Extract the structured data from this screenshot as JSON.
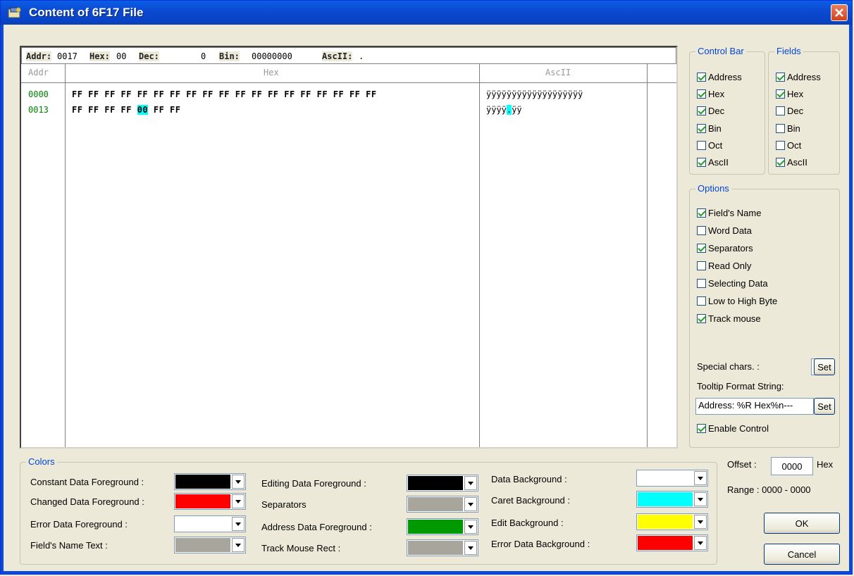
{
  "window": {
    "title": "Content of 6F17 File"
  },
  "control_bar": {
    "addr_label": "Addr:",
    "addr_value": "0017",
    "hex_label": "Hex:",
    "hex_value": "00",
    "dec_label": "Dec:",
    "dec_value": "0",
    "bin_label": "Bin:",
    "bin_value": "00000000",
    "ascii_label": "AscII:",
    "ascii_value": "."
  },
  "grid": {
    "headers": {
      "addr": "Addr",
      "hex": "Hex",
      "ascii": "AscII"
    },
    "rows": [
      {
        "addr": "0000",
        "hex_before": "FF FF FF FF FF FF FF FF FF FF FF FF FF FF FF FF FF FF FF",
        "hex_sel": "",
        "hex_after": "",
        "ascii_before": "ÿÿÿÿÿÿÿÿÿÿÿÿÿÿÿÿÿÿÿ",
        "ascii_sel": "",
        "ascii_after": ""
      },
      {
        "addr": "0013",
        "hex_before": "FF FF FF FF ",
        "hex_sel": "00",
        "hex_after": " FF FF",
        "ascii_before": "ÿÿÿÿ",
        "ascii_sel": ".",
        "ascii_after": "ÿÿ"
      }
    ]
  },
  "control_bar_group": {
    "title": "Control Bar",
    "items": [
      {
        "label": "Address",
        "checked": true
      },
      {
        "label": "Hex",
        "checked": true
      },
      {
        "label": "Dec",
        "checked": true
      },
      {
        "label": "Bin",
        "checked": true
      },
      {
        "label": "Oct",
        "checked": false
      },
      {
        "label": "AscII",
        "checked": true
      }
    ]
  },
  "fields_group": {
    "title": "Fields",
    "items": [
      {
        "label": "Address",
        "checked": true
      },
      {
        "label": "Hex",
        "checked": true
      },
      {
        "label": "Dec",
        "checked": false
      },
      {
        "label": "Bin",
        "checked": false
      },
      {
        "label": "Oct",
        "checked": false
      },
      {
        "label": "AscII",
        "checked": true
      }
    ]
  },
  "options_group": {
    "title": "Options",
    "items": [
      {
        "label": "Field's Name",
        "checked": true
      },
      {
        "label": "Word Data",
        "checked": false
      },
      {
        "label": "Separators",
        "checked": true
      },
      {
        "label": "Read Only",
        "checked": false
      },
      {
        "label": "Selecting Data",
        "checked": false
      },
      {
        "label": "Low to High Byte",
        "checked": false
      },
      {
        "label": "Track mouse",
        "checked": true
      }
    ],
    "special_chars_label": "Special chars. :",
    "special_chars_value": ".",
    "set_label": "Set",
    "tooltip_label": "Tooltip Format String:",
    "tooltip_value": "Address: %R Hex%n---",
    "enable_label": "Enable Control",
    "enable_checked": true
  },
  "colors_group": {
    "title": "Colors",
    "col1": [
      {
        "label": "Constant Data Foreground :",
        "color": "#000000"
      },
      {
        "label": "Changed Data Foreground :",
        "color": "#ff0000"
      },
      {
        "label": "Error Data Foreground :",
        "color": "#ffffff"
      },
      {
        "label": "Field's Name Text :",
        "color": "#a8a59c"
      }
    ],
    "col2": [
      {
        "label": "Editing Data Foreground :",
        "color": "#000000"
      },
      {
        "label": "Separators",
        "color": "#a8a59c"
      },
      {
        "label": "Address Data Foreground :",
        "color": "#009900"
      },
      {
        "label": "Track Mouse Rect :",
        "color": "#a8a59c"
      }
    ],
    "col3": [
      {
        "label": "Data Background :",
        "color": "#ffffff"
      },
      {
        "label": "Caret Background :",
        "color": "#00ffff"
      },
      {
        "label": "Edit Background :",
        "color": "#ffff00"
      },
      {
        "label": "Error Data Background :",
        "color": "#ff0000"
      }
    ]
  },
  "offset": {
    "label": "Offset :",
    "value": "0000",
    "unit": "Hex",
    "range": "Range :  0000 - 0000"
  },
  "buttons": {
    "ok": "OK",
    "cancel": "Cancel"
  }
}
